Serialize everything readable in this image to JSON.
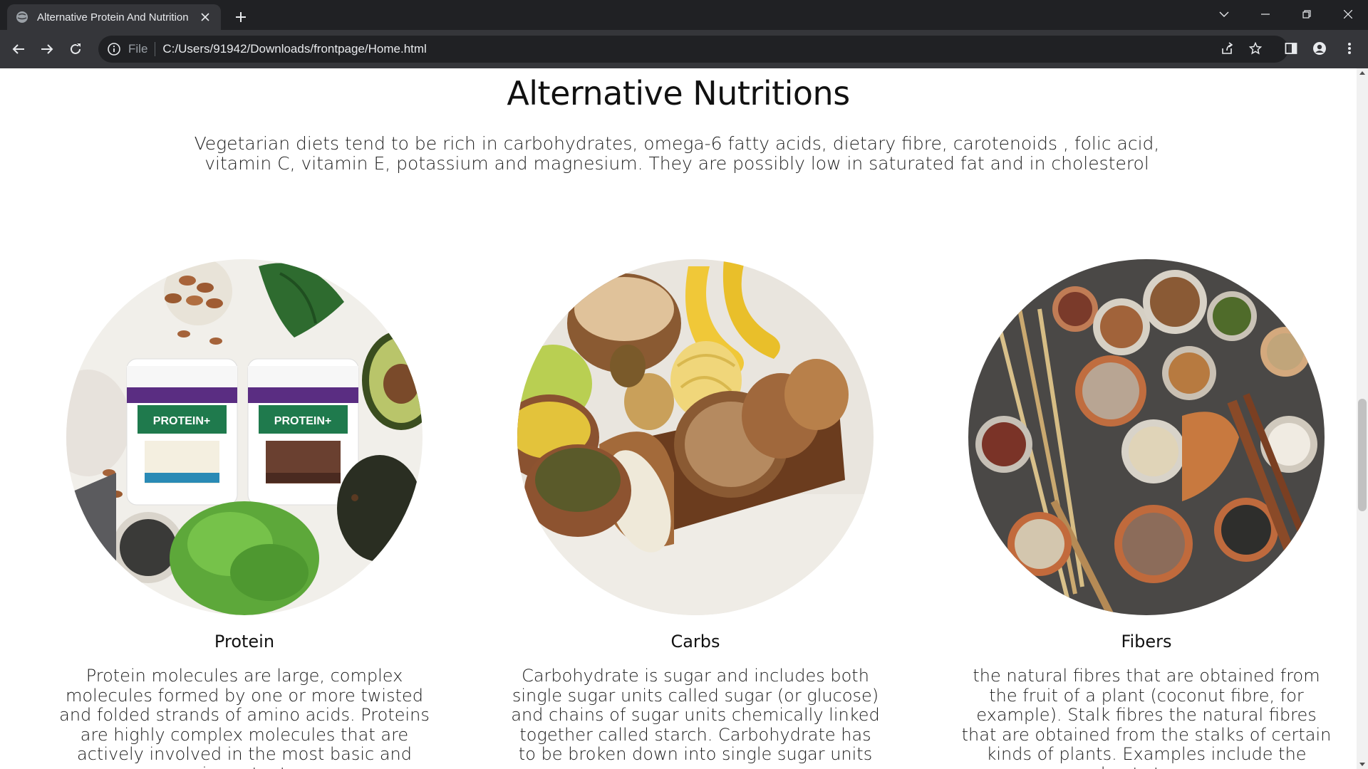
{
  "browser": {
    "tab_title": "Alternative Protein And Nutrition",
    "url_scheme": "File",
    "url": "C:/Users/91942/Downloads/frontpage/Home.html"
  },
  "page": {
    "title": "Alternative Nutritions",
    "intro": "Vegetarian diets tend to be rich in carbohydrates, omega-6 fatty acids, dietary fibre, carotenoids , folic acid, vitamin C, vitamin E, potassium and magnesium. They are possibly low in saturated fat and in cholesterol",
    "cards": [
      {
        "title": "Protein",
        "text": "Protein molecules are large, complex molecules formed by one or more twisted and folded strands of amino acids. Proteins are highly complex molecules that are actively involved in the most basic and important",
        "image": "protein-powder-and-greens-photo",
        "image_label": "PROTEIN+"
      },
      {
        "title": "Carbs",
        "text": "Carbohydrate is sugar and includes both single sugar units called sugar (or glucose) and chains of sugar units chemically linked together called starch. Carbohydrate has to be broken down into single sugar units",
        "image": "bread-grains-bananas-photo"
      },
      {
        "title": "Fibers",
        "text": "the natural fibres that are obtained from the fruit of a plant (coconut fibre, for example). Stalk fibres the natural fibres that are obtained from the stalks of certain kinds of plants. Examples include the wheat straws,",
        "image": "grains-and-legumes-bowls-photo"
      }
    ]
  },
  "colors": {
    "tabbar": "#202124",
    "toolbar": "#35363a",
    "text": "#111111"
  }
}
